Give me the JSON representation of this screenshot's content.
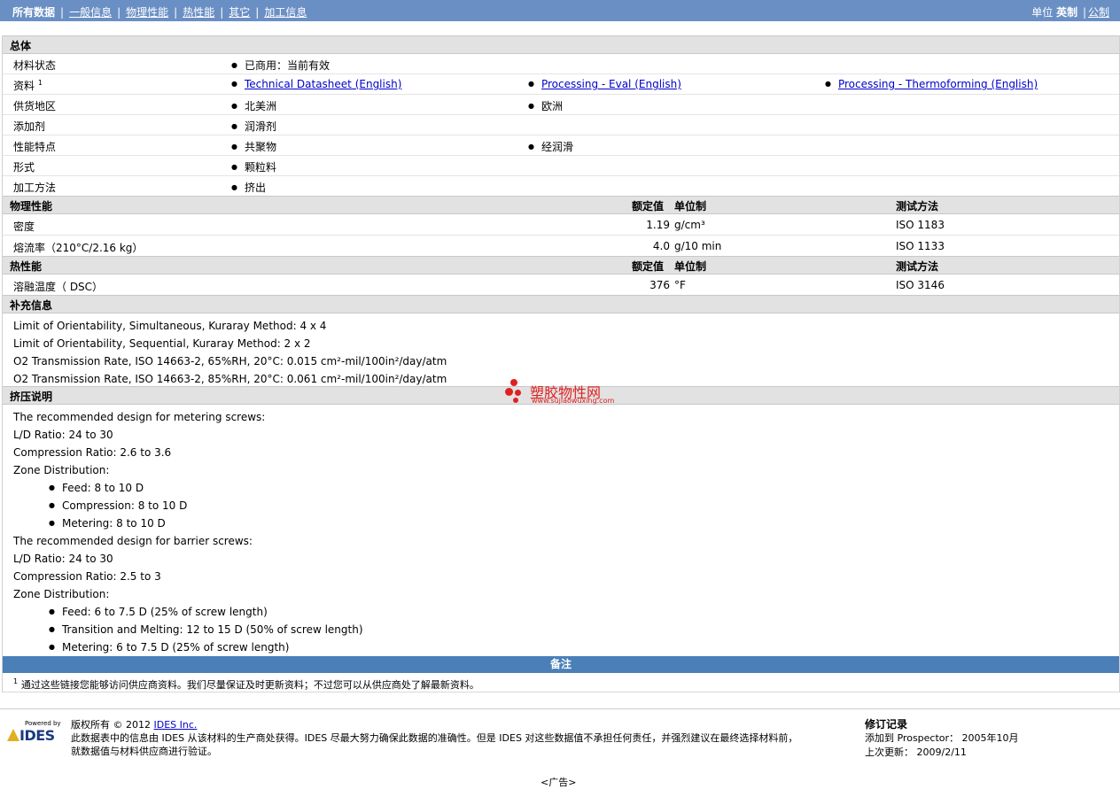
{
  "topnav": {
    "items": [
      "所有数据",
      "一般信息",
      "物理性能",
      "热性能",
      "其它",
      "加工信息"
    ],
    "units_label": "单位",
    "unit_active": "英制",
    "unit_other": "公制"
  },
  "general": {
    "title": "总体",
    "rows": [
      {
        "label": "材料状态",
        "values": [
          "已商用：当前有效"
        ]
      },
      {
        "label": "资料",
        "sup": "1",
        "links": [
          "Technical Datasheet (English)",
          "Processing - Eval (English)",
          "Processing - Thermoforming (English)"
        ]
      },
      {
        "label": "供货地区",
        "values": [
          "北美洲",
          "欧洲"
        ]
      },
      {
        "label": "添加剂",
        "values": [
          "润滑剂"
        ]
      },
      {
        "label": "性能特点",
        "values": [
          "共聚物",
          "经润滑"
        ]
      },
      {
        "label": "形式",
        "values": [
          "颗粒料"
        ]
      },
      {
        "label": "加工方法",
        "values": [
          "挤出"
        ]
      }
    ]
  },
  "physical": {
    "title": "物理性能",
    "col_nominal": "额定值",
    "col_unit": "单位制",
    "col_test": "测试方法",
    "rows": [
      {
        "label": "密度",
        "value": "1.19",
        "unit": "g/cm³",
        "test": "ISO 1183"
      },
      {
        "label": "熔流率（210°C/2.16 kg）",
        "value": "4.0",
        "unit": "g/10 min",
        "test": "ISO 1133"
      }
    ]
  },
  "thermal": {
    "title": "热性能",
    "col_nominal": "额定值",
    "col_unit": "单位制",
    "col_test": "测试方法",
    "rows": [
      {
        "label": "溶融温度（ DSC）",
        "value": "376",
        "unit": "°F",
        "test": "ISO 3146"
      }
    ]
  },
  "supplement": {
    "title": "补充信息",
    "lines": [
      "Limit of Orientability, Simultaneous, Kuraray Method: 4 x 4",
      "Limit of Orientability, Sequential, Kuraray Method: 2 x 2",
      "O2 Transmission Rate, ISO 14663-2, 65%RH, 20°C: 0.015 cm²-mil/100in²/day/atm",
      "O2 Transmission Rate, ISO 14663-2, 85%RH, 20°C: 0.061 cm²-mil/100in²/day/atm"
    ]
  },
  "extrusion": {
    "title": "挤压说明",
    "lines": [
      {
        "text": "The recommended design for metering screws:",
        "bullet": false
      },
      {
        "text": "L/D Ratio: 24 to 30",
        "bullet": false
      },
      {
        "text": "Compression Ratio: 2.6 to 3.6",
        "bullet": false
      },
      {
        "text": "Zone Distribution:",
        "bullet": false
      },
      {
        "text": "Feed: 8 to 10 D",
        "bullet": true
      },
      {
        "text": "Compression: 8 to 10 D",
        "bullet": true
      },
      {
        "text": "Metering: 8 to 10 D",
        "bullet": true
      },
      {
        "text": "The recommended design for barrier screws:",
        "bullet": false
      },
      {
        "text": "L/D Ratio: 24 to 30",
        "bullet": false
      },
      {
        "text": "Compression Ratio: 2.5 to 3",
        "bullet": false
      },
      {
        "text": "Zone Distribution:",
        "bullet": false
      },
      {
        "text": "Feed: 6 to 7.5 D (25% of screw length)",
        "bullet": true
      },
      {
        "text": "Transition and Melting: 12 to 15 D (50% of screw length)",
        "bullet": true
      },
      {
        "text": "Metering: 6 to 7.5 D (25% of screw length)",
        "bullet": true
      }
    ]
  },
  "notes": {
    "title": "备注",
    "sup": "1",
    "text": "通过这些链接您能够访问供应商资料。我们尽量保证及时更新资料；不过您可以从供应商处了解最新资料。"
  },
  "footer": {
    "logo_powered": "Powered by",
    "logo_name": "IDES",
    "copyright_prefix": "版权所有 © 2012",
    "copyright_link": "IDES Inc.",
    "disclaimer_1": "此数据表中的信息由 IDES 从该材料的生产商处获得。IDES 尽最大努力确保此数据的准确性。但是 IDES 对这些数据值不承担任何责任，并强烈建议在最终选择材料前，",
    "disclaimer_2": "就数据值与材料供应商进行验证。",
    "rev_title": "修订记录",
    "added_label": "添加到 Prospector：",
    "added_value": "2005年10月",
    "updated_label": "上次更新：",
    "updated_value": "2009/2/11",
    "ad": "<广告>"
  },
  "watermark": {
    "title": "塑胶物性网",
    "url": "www.sujiaowuxing.com"
  },
  "colors": {
    "topbar": "#6a8fc4",
    "notes_bar": "#4a7fb8",
    "section_bg": "#e2e2e2",
    "link": "#0000cc",
    "watermark": "#e02020"
  }
}
